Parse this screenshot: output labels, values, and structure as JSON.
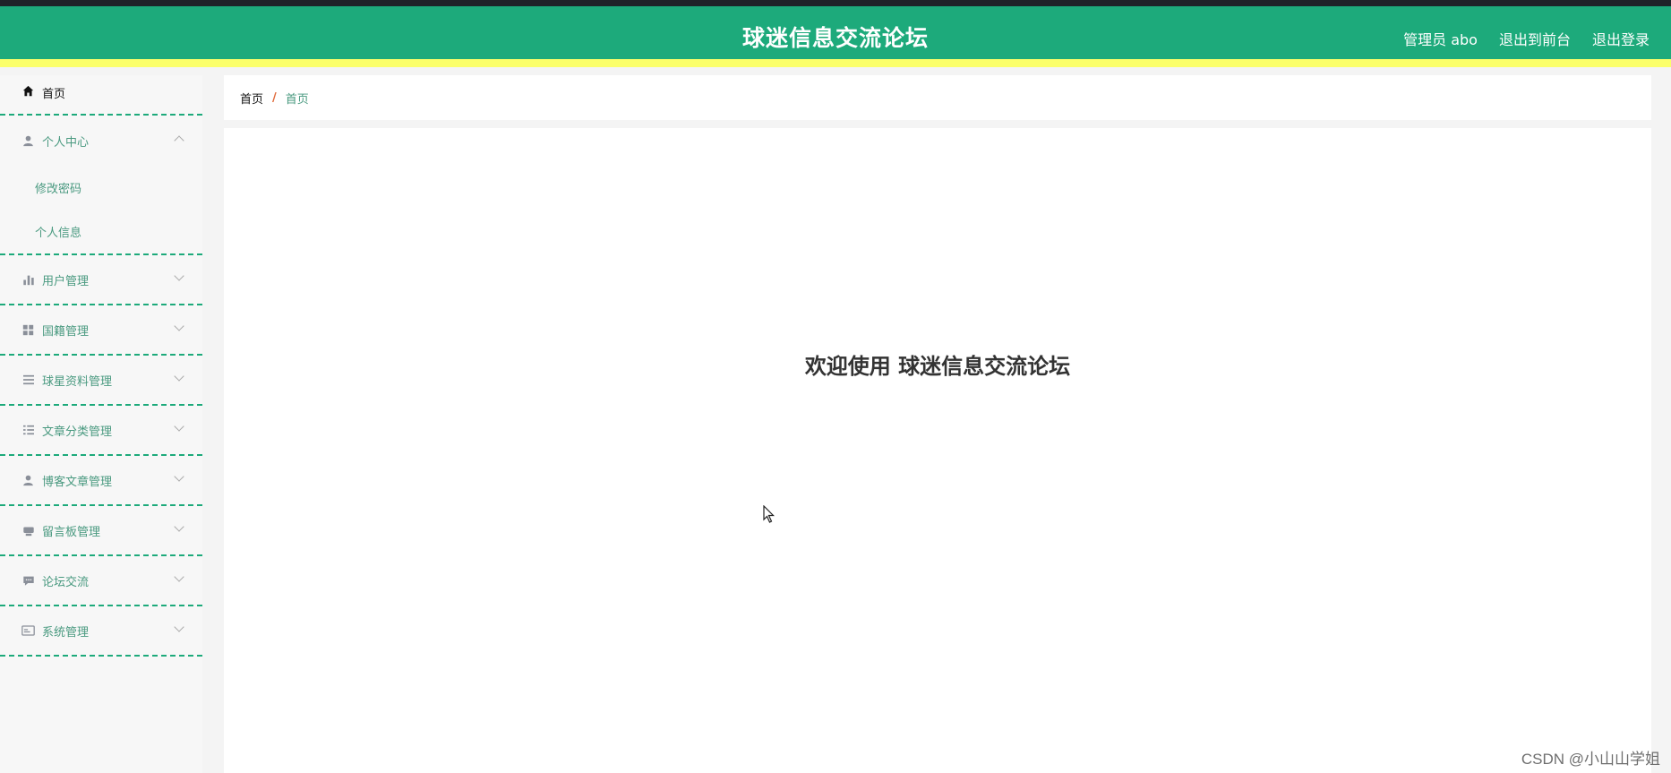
{
  "header": {
    "title": "球迷信息交流论坛",
    "user_label": "管理员 abo",
    "to_front_label": "退出到前台",
    "logout_label": "退出登录"
  },
  "sidebar": {
    "home": {
      "label": "首页",
      "icon": "home-icon"
    },
    "personal": {
      "label": "个人中心",
      "icon": "user-icon",
      "expanded": true,
      "children": [
        "修改密码",
        "个人信息"
      ]
    },
    "items": [
      {
        "label": "用户管理",
        "icon": "bar-chart-icon"
      },
      {
        "label": "国籍管理",
        "icon": "grid-icon"
      },
      {
        "label": "球星资料管理",
        "icon": "list-icon"
      },
      {
        "label": "文章分类管理",
        "icon": "list-icon"
      },
      {
        "label": "博客文章管理",
        "icon": "user-icon"
      },
      {
        "label": "留言板管理",
        "icon": "printer-icon"
      },
      {
        "label": "论坛交流",
        "icon": "chat-icon"
      },
      {
        "label": "系统管理",
        "icon": "card-icon"
      }
    ]
  },
  "breadcrumb": {
    "root": "首页",
    "separator": "/",
    "current": "首页"
  },
  "main": {
    "welcome": "欢迎使用 球迷信息交流论坛"
  },
  "watermark": "CSDN @小山山学姐",
  "colors": {
    "accent": "#1daa7b",
    "highlight": "#fbff6a"
  }
}
